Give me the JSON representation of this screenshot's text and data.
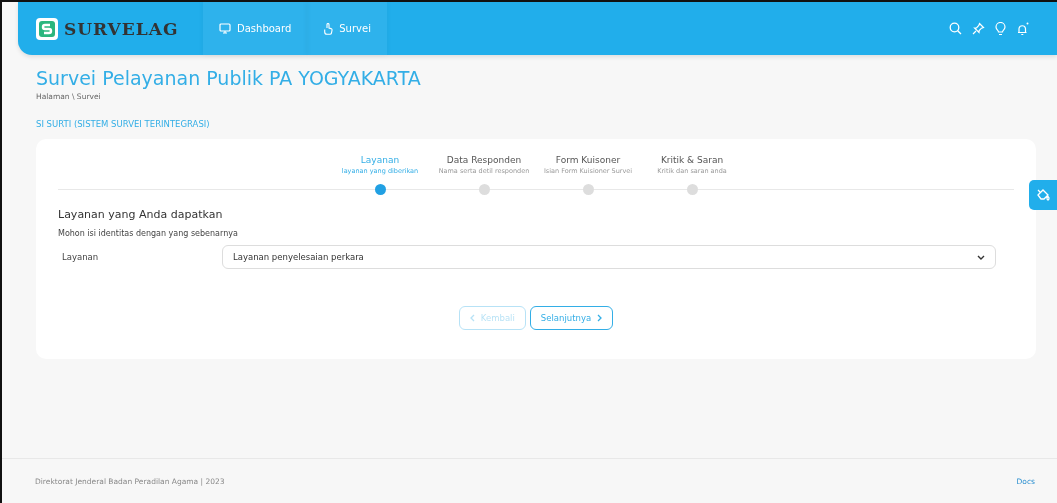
{
  "header": {
    "logo": "SURVELAG",
    "nav": [
      {
        "label": "Dashboard",
        "selected": false
      },
      {
        "label": "Survei",
        "selected": false
      }
    ]
  },
  "page": {
    "title": "Survei Pelayanan Publik PA YOGYAKARTA",
    "breadcrumb": "Halaman \\ Survei",
    "section": "SI SURTI (SISTEM SURVEI TERINTEGRASI)"
  },
  "steps": [
    {
      "title": "Layanan",
      "subtitle": "layanan yang diberikan",
      "selected": true
    },
    {
      "title": "Data Responden",
      "subtitle": "Nama serta detil responden",
      "selected": false
    },
    {
      "title": "Form Kuisoner",
      "subtitle": "Isian Form Kuisioner Survei",
      "selected": false
    },
    {
      "title": "Kritik & Saran",
      "subtitle": "Kritik dan saran anda",
      "selected": false
    }
  ],
  "form": {
    "heading": "Layanan yang Anda dapatkan",
    "hint": "Mohon isi identitas dengan yang sebenarnya",
    "fields": [
      {
        "label": "Layanan",
        "value": "Layanan penyelesaian perkara"
      }
    ]
  },
  "buttons": [
    {
      "label": "Kembali",
      "kind": "back",
      "disabled": true
    },
    {
      "label": "Selanjutnya",
      "kind": "next",
      "disabled": false
    }
  ],
  "footer": {
    "text": "Direktorat Jenderal Badan Peradilan Agama | 2023",
    "link": "Docs"
  }
}
